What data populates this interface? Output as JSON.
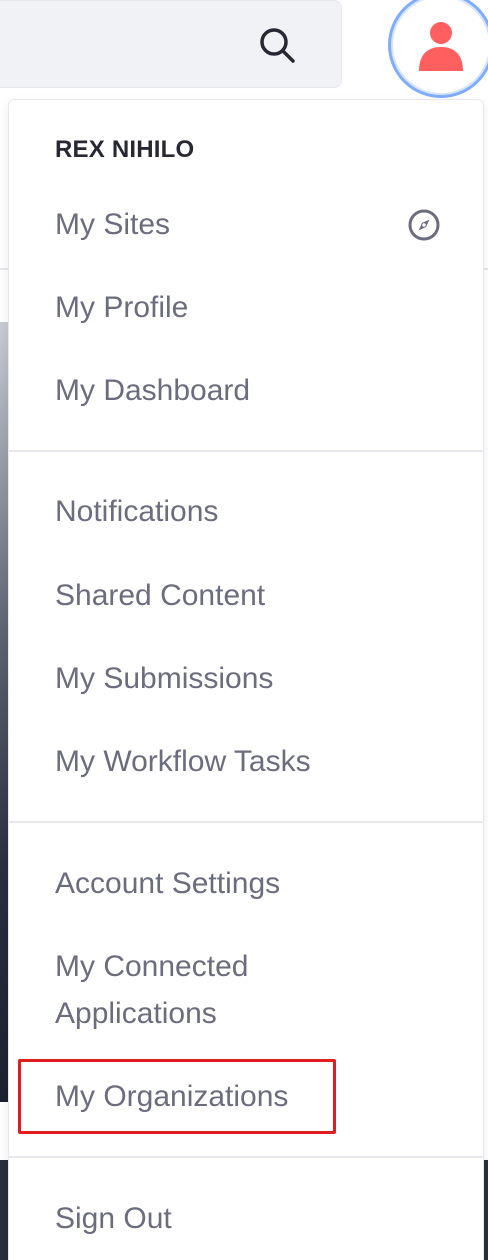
{
  "header": {
    "search_icon": "search-icon",
    "avatar_icon": "user-icon",
    "avatar_color": "#ff5f5f",
    "avatar_ring_color": "#80acff"
  },
  "menu": {
    "user_name": "REX NIHILO",
    "section1": {
      "my_sites": "My Sites",
      "my_sites_icon": "compass-icon",
      "my_profile": "My Profile",
      "my_dashboard": "My Dashboard"
    },
    "section2": {
      "notifications": "Notifications",
      "shared_content": "Shared Content",
      "my_submissions": "My Submissions",
      "my_workflow_tasks": "My Workflow Tasks"
    },
    "section3": {
      "account_settings": "Account Settings",
      "my_connected_line1": "My Connected",
      "my_connected_line2": "Applications",
      "my_organizations": "My Organizations"
    },
    "section4": {
      "sign_out": "Sign Out"
    },
    "highlight_color": "#e11e1e"
  }
}
